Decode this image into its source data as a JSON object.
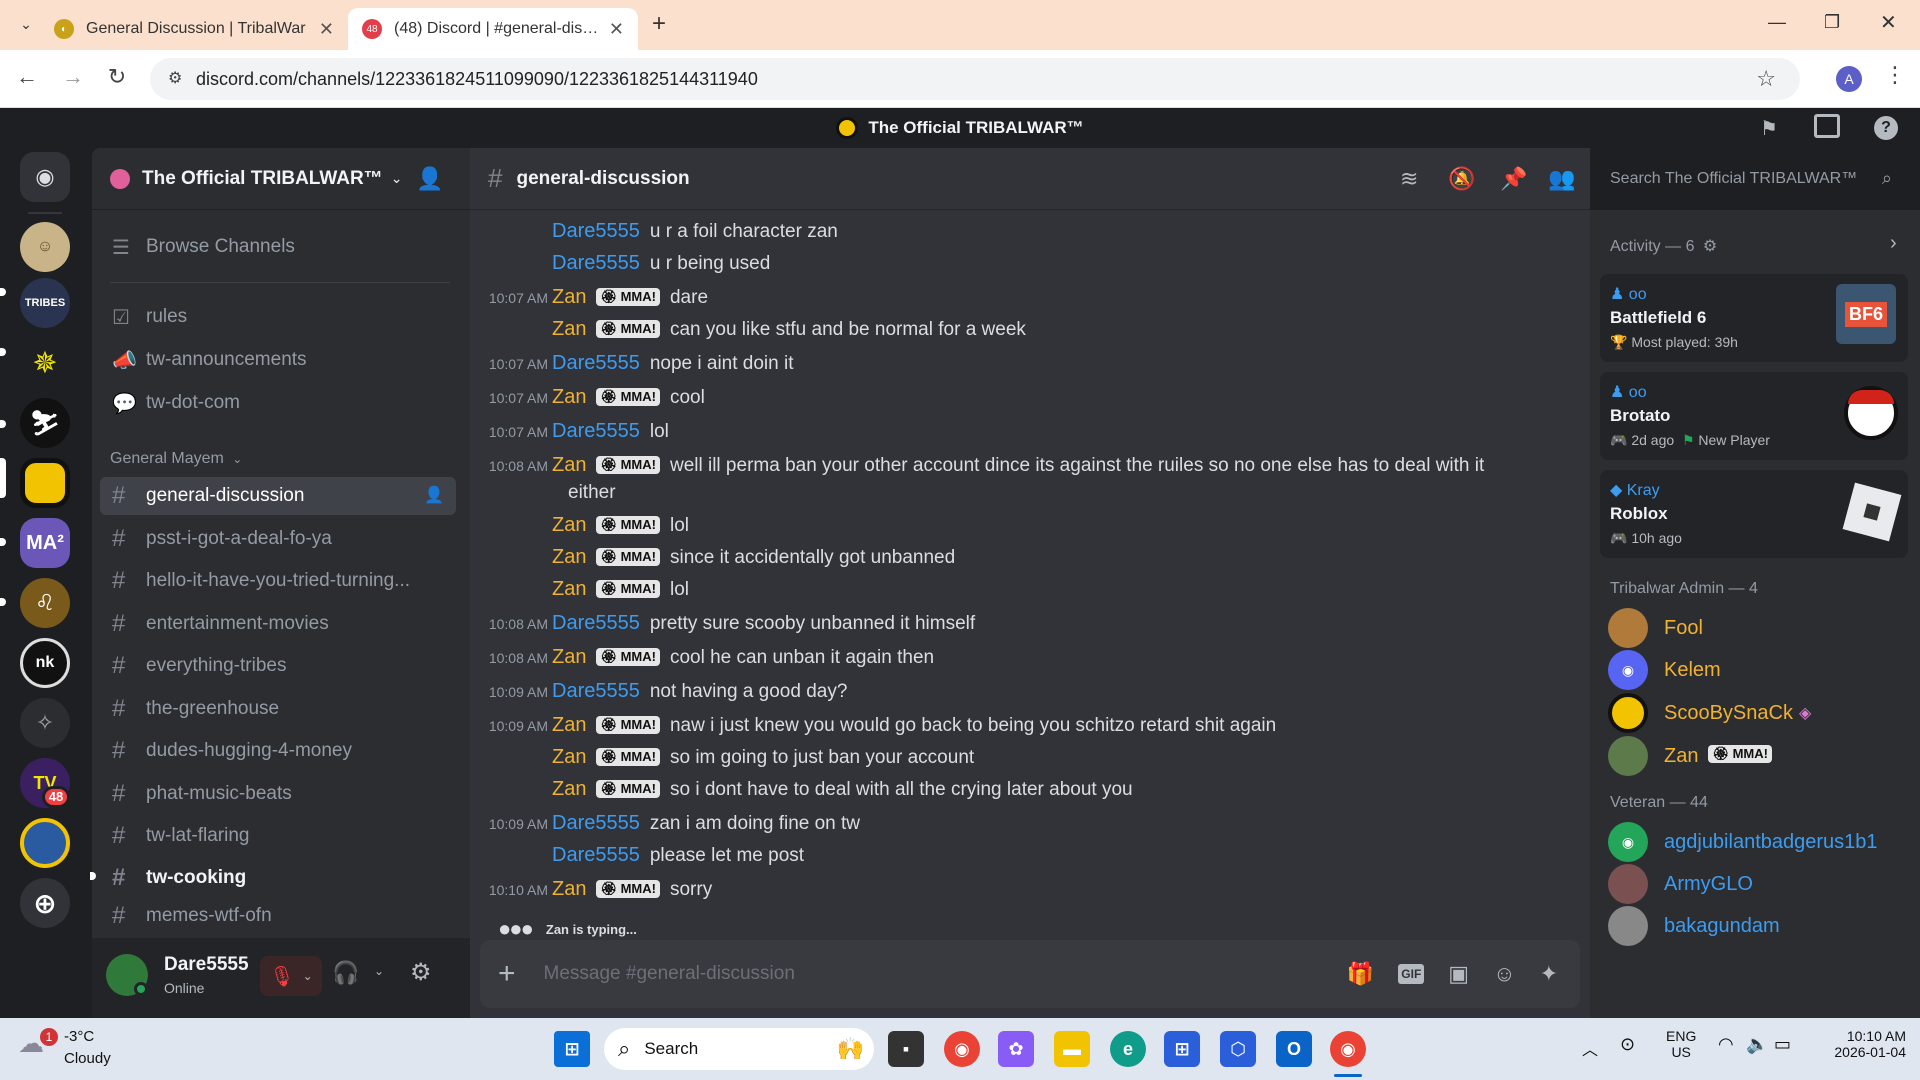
{
  "browser": {
    "tabs": [
      {
        "title": "General Discussion | TribalWar",
        "active": false
      },
      {
        "title": "(48) Discord | #general-discussi",
        "active": true,
        "badge": "48"
      }
    ],
    "url": "discord.com/channels/1223361824511099090/1223361825144311940",
    "profile_initial": "A"
  },
  "discord": {
    "top_title": "The Official TRIBALWAR™",
    "server_name": "The Official TRIBALWAR™",
    "guild_badge": "48",
    "browse_channels": "Browse Channels",
    "top_channels": [
      {
        "name": "rules",
        "icon": "rules-icon"
      },
      {
        "name": "tw-announcements",
        "icon": "megaphone-icon"
      },
      {
        "name": "tw-dot-com",
        "icon": "forum-icon"
      }
    ],
    "category": "General Mayem",
    "channels": [
      {
        "name": "general-discussion",
        "state": "selected"
      },
      {
        "name": "psst-i-got-a-deal-fo-ya",
        "state": "normal"
      },
      {
        "name": "hello-it-have-you-tried-turning...",
        "state": "normal"
      },
      {
        "name": "entertainment-movies",
        "state": "normal"
      },
      {
        "name": "everything-tribes",
        "state": "normal"
      },
      {
        "name": "the-greenhouse",
        "state": "normal"
      },
      {
        "name": "dudes-hugging-4-money",
        "state": "normal"
      },
      {
        "name": "phat-music-beats",
        "state": "normal"
      },
      {
        "name": "tw-lat-flaring",
        "state": "normal"
      },
      {
        "name": "tw-cooking",
        "state": "unread"
      },
      {
        "name": "memes-wtf-ofn",
        "state": "normal"
      }
    ],
    "user": {
      "name": "Dare5555",
      "status": "Online"
    },
    "channel_header": "general-discussion",
    "search_placeholder": "Search The Official TRIBALWAR™",
    "tag_label": "MMA!",
    "messages": [
      {
        "time": "",
        "author": "Dare5555",
        "text": "u r a foil character zan"
      },
      {
        "time": "",
        "author": "Dare5555",
        "text": "u r being used"
      },
      {
        "time": "10:07 AM",
        "author": "Zan",
        "text": "dare"
      },
      {
        "time": "",
        "author": "Zan",
        "text": "can you like stfu and be normal for a week"
      },
      {
        "time": "10:07 AM",
        "author": "Dare5555",
        "text": "nope i aint doin it"
      },
      {
        "time": "10:07 AM",
        "author": "Zan",
        "text": "cool"
      },
      {
        "time": "10:07 AM",
        "author": "Dare5555",
        "text": "lol"
      },
      {
        "time": "10:08 AM",
        "author": "Zan",
        "text": "well ill perma ban your other account dince its against the ruiles so no one else has to deal with it",
        "text2": "either"
      },
      {
        "time": "",
        "author": "Zan",
        "text": "lol"
      },
      {
        "time": "",
        "author": "Zan",
        "text": "since it accidentally got unbanned"
      },
      {
        "time": "",
        "author": "Zan",
        "text": "lol"
      },
      {
        "time": "10:08 AM",
        "author": "Dare5555",
        "text": "pretty sure scooby unbanned it himself"
      },
      {
        "time": "10:08 AM",
        "author": "Zan",
        "text": "cool he can unban it again then"
      },
      {
        "time": "10:09 AM",
        "author": "Dare5555",
        "text": "not having a good day?"
      },
      {
        "time": "10:09 AM",
        "author": "Zan",
        "text": "naw i just knew you would go back to being you schitzo retard shit again"
      },
      {
        "time": "",
        "author": "Zan",
        "text": "so im going to just ban your account"
      },
      {
        "time": "",
        "author": "Zan",
        "text": "so i dont have to deal with all the crying later about you"
      },
      {
        "time": "10:09 AM",
        "author": "Dare5555",
        "text": "zan i am doing fine on tw"
      },
      {
        "time": "",
        "author": "Dare5555",
        "text": "please let me post"
      },
      {
        "time": "10:10 AM",
        "author": "Zan",
        "text": "sorry"
      }
    ],
    "typing": "Zan is typing...",
    "composer_placeholder": "Message #general-discussion",
    "activity": {
      "header": "Activity — 6",
      "cards": [
        {
          "user": "oo",
          "game": "Battlefield 6",
          "detail": "Most played: 39h",
          "detail2": "",
          "thumb": "BF6"
        },
        {
          "user": "oo",
          "game": "Brotato",
          "detail": "2d ago",
          "detail2": "New Player",
          "thumb": ""
        },
        {
          "user": "Kray",
          "game": "Roblox",
          "detail": "10h ago",
          "detail2": "",
          "thumb": ""
        }
      ]
    },
    "admin_header": "Tribalwar Admin — 4",
    "admins": [
      {
        "name": "Fool",
        "color": "#f0b232"
      },
      {
        "name": "Kelem",
        "color": "#f0b232"
      },
      {
        "name": "ScooBySnaCk",
        "color": "#f0b232"
      },
      {
        "name": "Zan",
        "color": "#f0b232"
      }
    ],
    "veteran_header": "Veteran — 44",
    "veterans": [
      {
        "name": "agdjubilantbadgerus1b1",
        "color": "#3e9cf0"
      },
      {
        "name": "ArmyGLO",
        "color": "#3e9cf0"
      },
      {
        "name": "bakagundam",
        "color": "#3e9cf0"
      }
    ]
  },
  "taskbar": {
    "weather_temp": "-3°C",
    "weather_desc": "Cloudy",
    "weather_badge": "1",
    "search_label": "Search",
    "lang1": "ENG",
    "lang2": "US",
    "time": "10:10 AM",
    "date": "2026-01-04"
  }
}
